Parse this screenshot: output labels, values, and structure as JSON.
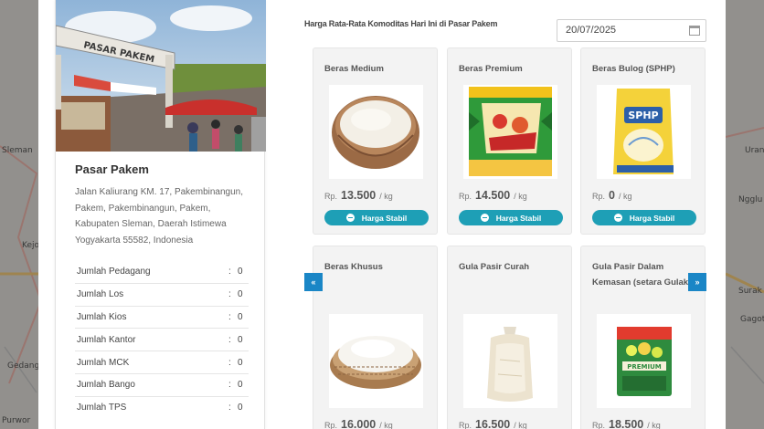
{
  "map": {
    "labels": [
      "Sleman",
      "Kejo",
      "Gedang",
      "Purwor",
      "Surak",
      "Ngglu",
      "Gagot",
      "Uran"
    ]
  },
  "market": {
    "name": "Pasar Pakem",
    "address": "Jalan Kaliurang KM. 17, Pakembinangun, Pakem, Pakembinangun, Pakem, Kabupaten Sleman, Daerah Istimewa Yogyakarta 55582, Indonesia",
    "photo_sign": "PASAR PAKEM",
    "stats": [
      {
        "label": "Jumlah Pedagang",
        "sep": ":",
        "value": "0"
      },
      {
        "label": "Jumlah Los",
        "sep": ":",
        "value": "0"
      },
      {
        "label": "Jumlah Kios",
        "sep": ":",
        "value": "0"
      },
      {
        "label": "Jumlah Kantor",
        "sep": ":",
        "value": "0"
      },
      {
        "label": "Jumlah MCK",
        "sep": ":",
        "value": "0"
      },
      {
        "label": "Jumlah Bango",
        "sep": ":",
        "value": "0"
      },
      {
        "label": "Jumlah TPS",
        "sep": ":",
        "value": "0"
      }
    ]
  },
  "prices": {
    "headline": "Harga Rata-Rata Komoditas Hari Ini di Pasar Pakem",
    "date": "20/07/2025",
    "currency": "Rp.",
    "unit": "/ kg",
    "status_label": "Harga Stabil",
    "prev_label": "«",
    "next_label": "»",
    "items": [
      {
        "name": "Beras Medium",
        "price": "13.500",
        "image": "rice-bowl"
      },
      {
        "name": "Beras Premium",
        "price": "14.500",
        "image": "rice-bag-green"
      },
      {
        "name": "Beras Bulog (SPHP)",
        "price": "0",
        "image": "rice-bag-sphp",
        "bag_text": "SPHP"
      },
      {
        "name": "Beras Khusus",
        "price": "16.000",
        "image": "rice-basket"
      },
      {
        "name": "Gula Pasir Curah",
        "price": "16.500",
        "image": "sugar-bag"
      },
      {
        "name": "Gula Pasir Dalam Kemasan (setara Gulaku)",
        "price": "18.500",
        "image": "sugar-pack-green",
        "bag_text": "PREMIUM"
      }
    ]
  },
  "colors": {
    "accent": "#1e9fb6",
    "nav": "#1a86c6"
  }
}
